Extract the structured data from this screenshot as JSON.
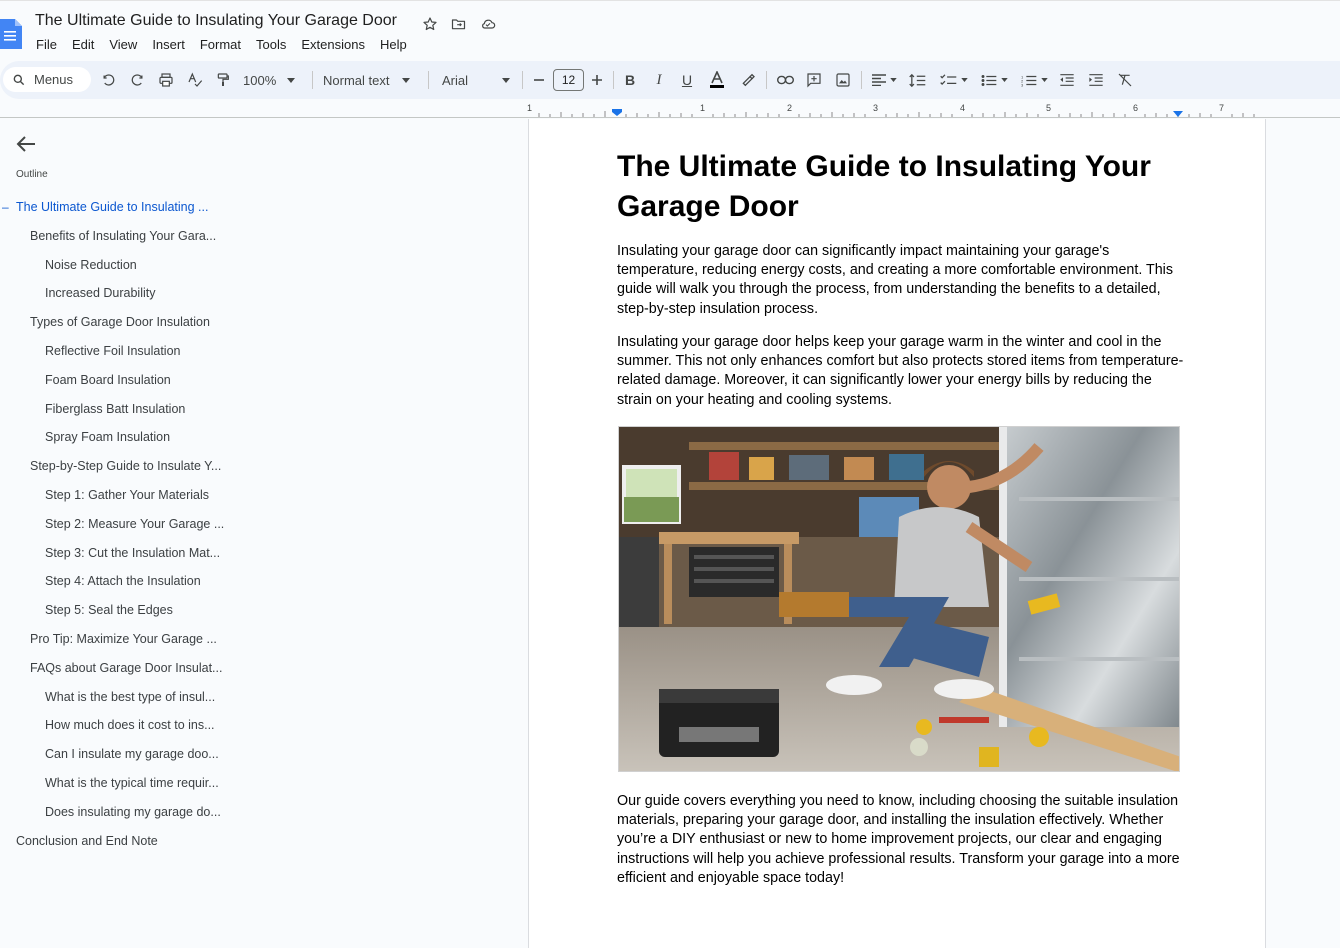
{
  "document": {
    "title": "The Ultimate Guide to Insulating Your Garage Door"
  },
  "menu": [
    "File",
    "Edit",
    "View",
    "Insert",
    "Format",
    "Tools",
    "Extensions",
    "Help"
  ],
  "toolbar": {
    "search_label": "Menus",
    "zoom": "100%",
    "style": "Normal text",
    "font": "Arial",
    "font_size": "12"
  },
  "ruler": {
    "numbers": [
      "1",
      "1",
      "2",
      "3",
      "4",
      "5",
      "6",
      "7"
    ]
  },
  "outline": {
    "label": "Outline",
    "items": [
      {
        "text": "The Ultimate Guide to Insulating ...",
        "level": 1,
        "active": true
      },
      {
        "text": "Benefits of Insulating Your Gara...",
        "level": 2
      },
      {
        "text": "Noise Reduction",
        "level": 3
      },
      {
        "text": "Increased Durability",
        "level": 3
      },
      {
        "text": "Types of Garage Door Insulation",
        "level": 2
      },
      {
        "text": "Reflective Foil Insulation",
        "level": 3
      },
      {
        "text": "Foam Board Insulation",
        "level": 3
      },
      {
        "text": "Fiberglass Batt Insulation",
        "level": 3
      },
      {
        "text": "Spray Foam Insulation",
        "level": 3
      },
      {
        "text": "Step-by-Step Guide to Insulate Y...",
        "level": 2
      },
      {
        "text": "Step 1: Gather Your Materials",
        "level": 3
      },
      {
        "text": "Step 2: Measure Your Garage ...",
        "level": 3
      },
      {
        "text": "Step 3: Cut the Insulation Mat...",
        "level": 3
      },
      {
        "text": "Step 4: Attach the Insulation",
        "level": 3
      },
      {
        "text": "Step 5: Seal the Edges",
        "level": 3
      },
      {
        "text": "Pro Tip: Maximize Your Garage ...",
        "level": 2
      },
      {
        "text": "FAQs about Garage Door Insulat...",
        "level": 2
      },
      {
        "text": "What is the best type of insul...",
        "level": 3
      },
      {
        "text": "How much does it cost to ins...",
        "level": 3
      },
      {
        "text": "Can I insulate my garage doo...",
        "level": 3
      },
      {
        "text": "What is the typical time requir...",
        "level": 3
      },
      {
        "text": "Does insulating my garage do...",
        "level": 3
      },
      {
        "text": "Conclusion and End Note",
        "level": 1
      }
    ]
  },
  "page": {
    "heading": "The Ultimate Guide to Insulating Your Garage Door",
    "paragraphs": [
      "Insulating your garage door can significantly impact maintaining your garage's temperature, reducing energy costs, and creating a more comfortable environment. This guide will walk you through the process, from understanding the benefits to a detailed, step-by-step insulation process.",
      "Insulating your garage door helps keep your garage warm in the winter and cool in the summer. This not only enhances comfort but also protects stored items from temperature-related damage. Moreover, it can significantly lower your energy bills by reducing the strain on your heating and cooling systems.",
      "Our guide covers everything you need to know, including choosing the suitable insulation materials, preparing your garage door, and installing the insulation effectively. Whether you’re a DIY enthusiast or new to home improvement projects, our clear and engaging instructions will help you achieve professional results. Transform your garage into a more efficient and enjoyable space today!"
    ]
  },
  "colors": {
    "accent": "#0b57d0",
    "toolbar_bg": "#edf2fa",
    "docs_blue": "#4285f4"
  }
}
